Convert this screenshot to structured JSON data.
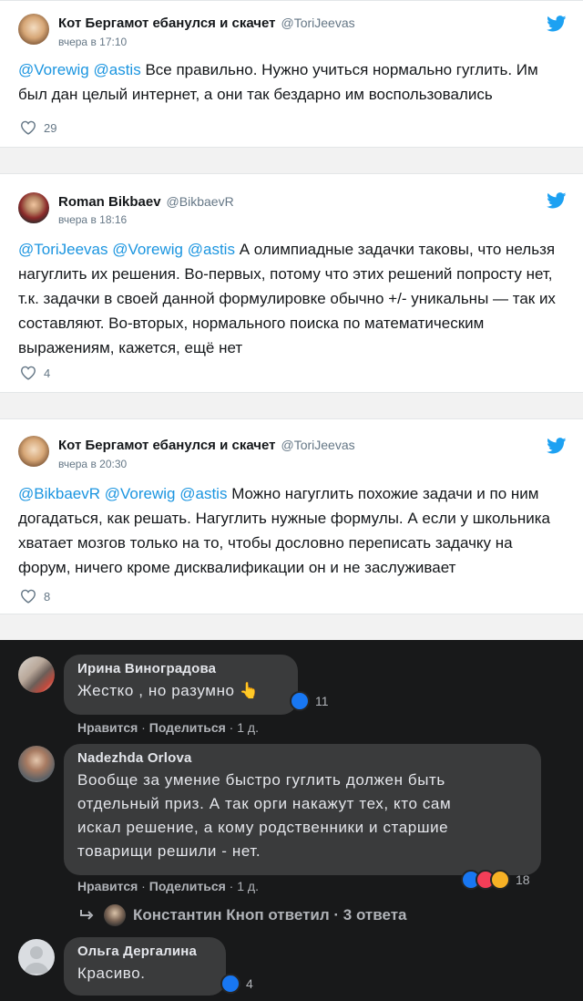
{
  "tweets": [
    {
      "author": "Кот Бергамот ебанулся и скачет",
      "handle": "@ToriJeevas",
      "time": "вчера в 17:10",
      "mentions": [
        "@Vorewig",
        "@astis"
      ],
      "text": "Все правильно. Нужно учиться нормально гуглить. Им был дан целый интернет, а они так бездарно им воспользовались",
      "likes": "29"
    },
    {
      "author": "Roman Bikbaev",
      "handle": "@BikbaevR",
      "time": "вчера в 18:16",
      "mentions": [
        "@ToriJeevas",
        "@Vorewig",
        "@astis"
      ],
      "text": "А олимпиадные задачки таковы, что нельзя нагуглить их решения. Во-первых, потому что этих решений попросту нет, т.к. задачки в своей данной формулировке обычно +/- уникальны — так их составляют. Во-вторых, нормального поиска по математическим выражениям, кажется, ещё нет",
      "likes": "4"
    },
    {
      "author": "Кот Бергамот ебанулся и скачет",
      "handle": "@ToriJeevas",
      "time": "вчера в 20:30",
      "mentions": [
        "@BikbaevR",
        "@Vorewig",
        "@astis"
      ],
      "text": "Можно нагуглить похожие задачи и по ним догадаться, как решать. Нагуглить нужные формулы. А если у школьника хватает мозгов только на то, чтобы дословно переписать задачку на форум, ничего кроме дисквалификации он и не заслуживает",
      "likes": "8"
    }
  ],
  "facebook": {
    "comments": [
      {
        "author": "Ирина Виноградова",
        "text": "Жестко , но разумно 👆",
        "reactions": "11",
        "like_label": "Нравится",
        "share_label": "Поделиться",
        "age": "1 д."
      },
      {
        "author": "Nadezhda Orlova",
        "text_lines": [
          "Вообще за умение быстро гуглить должен быть",
          "отдельный приз. А так орги накажут тех, кто сам",
          "искал решение, а кому родственники и старшие",
          "товарищи решили - нет."
        ],
        "reactions": "18",
        "like_label": "Нравится",
        "share_label": "Поделиться",
        "age": "1 д."
      },
      {
        "author": "Ольга Дергалина",
        "text": "Красиво.",
        "reactions": "4"
      }
    ],
    "reply": {
      "author": "Константин Кноп",
      "action": "ответил",
      "count": "3 ответа"
    }
  },
  "colors": {
    "mention": "#1b95e0",
    "twitter_blue": "#1da1f2",
    "fb_bg": "#18191a",
    "fb_bubble": "#3a3b3c"
  }
}
